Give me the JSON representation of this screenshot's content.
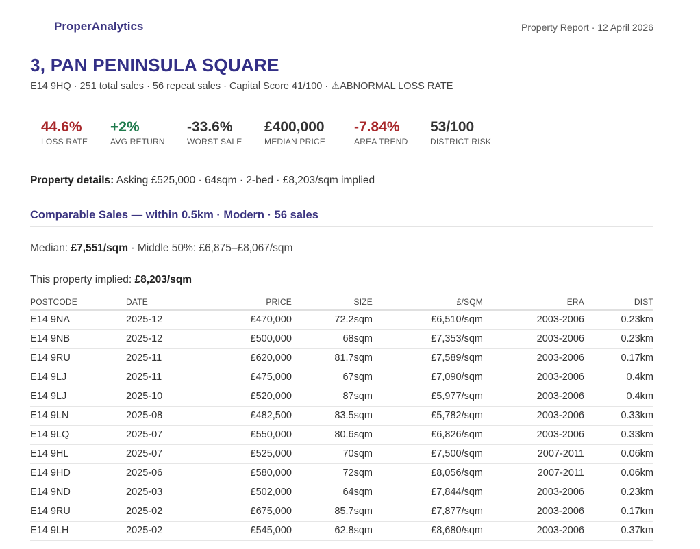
{
  "header": {
    "brand": "ProperAnalytics",
    "report_meta": "Property Report · 12 April 2026"
  },
  "property": {
    "title": "3, PAN PENINSULA SQUARE",
    "subtitle_main": "E14 9HQ · 251 total sales · 56 repeat sales · Capital Score 41/100 · ",
    "warning_icon": "⚠",
    "warning_text": "ABNORMAL LOSS RATE"
  },
  "metrics": [
    {
      "value": "44.6%",
      "label": "LOSS RATE",
      "color": "#a8282b"
    },
    {
      "value": "+2%",
      "label": "AVG RETURN",
      "color": "#1e7a4c"
    },
    {
      "value": "-33.6%",
      "label": "WORST SALE",
      "color": "#333333"
    },
    {
      "value": "£400,000",
      "label": "MEDIAN PRICE",
      "color": "#333333"
    },
    {
      "value": "-7.84%",
      "label": "AREA TREND",
      "color": "#a8282b"
    },
    {
      "value": "53/100",
      "label": "DISTRICT RISK",
      "color": "#333333"
    }
  ],
  "details": {
    "label": "Property details:",
    "text": " Asking £525,000 · 64sqm · 2-bed · £8,203/sqm implied"
  },
  "comparables": {
    "section_title": "Comparable Sales — within 0.5km · Modern · 56 sales",
    "median_label": "Median: ",
    "median_value": "£7,551/sqm",
    "middle_text": " · Middle 50%: £6,875–£8,067/sqm",
    "implied_label": "This property implied: ",
    "implied_value": "£8,203/sqm",
    "columns": [
      "POSTCODE",
      "DATE",
      "PRICE",
      "SIZE",
      "£/SQM",
      "ERA",
      "DIST"
    ],
    "rows": [
      [
        "E14 9NA",
        "2025-12",
        "£470,000",
        "72.2sqm",
        "£6,510/sqm",
        "2003-2006",
        "0.23km"
      ],
      [
        "E14 9NB",
        "2025-12",
        "£500,000",
        "68sqm",
        "£7,353/sqm",
        "2003-2006",
        "0.23km"
      ],
      [
        "E14 9RU",
        "2025-11",
        "£620,000",
        "81.7sqm",
        "£7,589/sqm",
        "2003-2006",
        "0.17km"
      ],
      [
        "E14 9LJ",
        "2025-11",
        "£475,000",
        "67sqm",
        "£7,090/sqm",
        "2003-2006",
        "0.4km"
      ],
      [
        "E14 9LJ",
        "2025-10",
        "£520,000",
        "87sqm",
        "£5,977/sqm",
        "2003-2006",
        "0.4km"
      ],
      [
        "E14 9LN",
        "2025-08",
        "£482,500",
        "83.5sqm",
        "£5,782/sqm",
        "2003-2006",
        "0.33km"
      ],
      [
        "E14 9LQ",
        "2025-07",
        "£550,000",
        "80.6sqm",
        "£6,826/sqm",
        "2003-2006",
        "0.33km"
      ],
      [
        "E14 9HL",
        "2025-07",
        "£525,000",
        "70sqm",
        "£7,500/sqm",
        "2007-2011",
        "0.06km"
      ],
      [
        "E14 9HD",
        "2025-06",
        "£580,000",
        "72sqm",
        "£8,056/sqm",
        "2007-2011",
        "0.06km"
      ],
      [
        "E14 9ND",
        "2025-03",
        "£502,000",
        "64sqm",
        "£7,844/sqm",
        "2003-2006",
        "0.23km"
      ],
      [
        "E14 9RU",
        "2025-02",
        "£675,000",
        "85.7sqm",
        "£7,877/sqm",
        "2003-2006",
        "0.17km"
      ],
      [
        "E14 9LH",
        "2025-02",
        "£545,000",
        "62.8sqm",
        "£8,680/sqm",
        "2003-2006",
        "0.37km"
      ]
    ]
  }
}
